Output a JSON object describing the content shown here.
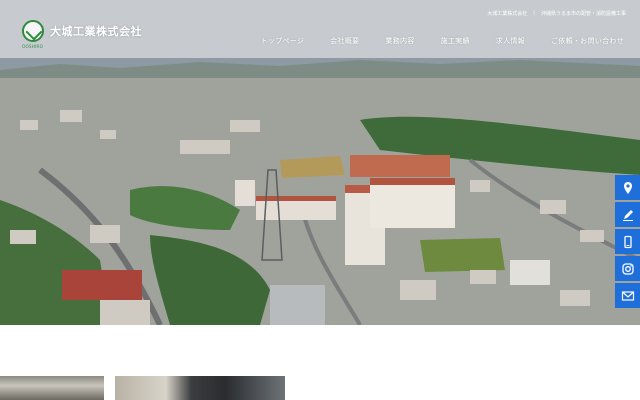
{
  "site": {
    "logo_name": "大城工業株式会社",
    "logo_sub": "OOSHIRO"
  },
  "topbar": {
    "company": "大城工業株式会社",
    "tagline": "沖縄県うるま市の配管・消防設備工事"
  },
  "nav": {
    "items": [
      {
        "label": "トップページ"
      },
      {
        "label": "会社概要"
      },
      {
        "label": "業務内容"
      },
      {
        "label": "施工実績"
      },
      {
        "label": "求人情報"
      },
      {
        "label": "ご依頼・お問い合わせ"
      }
    ]
  },
  "side_icons": [
    {
      "icon": "map-pin-icon"
    },
    {
      "icon": "pen-icon"
    },
    {
      "icon": "phone-icon"
    },
    {
      "icon": "instagram-icon"
    },
    {
      "icon": "mail-icon"
    }
  ],
  "colors": {
    "accent_blue": "#1e6fd9",
    "logo_green": "#2e8b3d"
  }
}
